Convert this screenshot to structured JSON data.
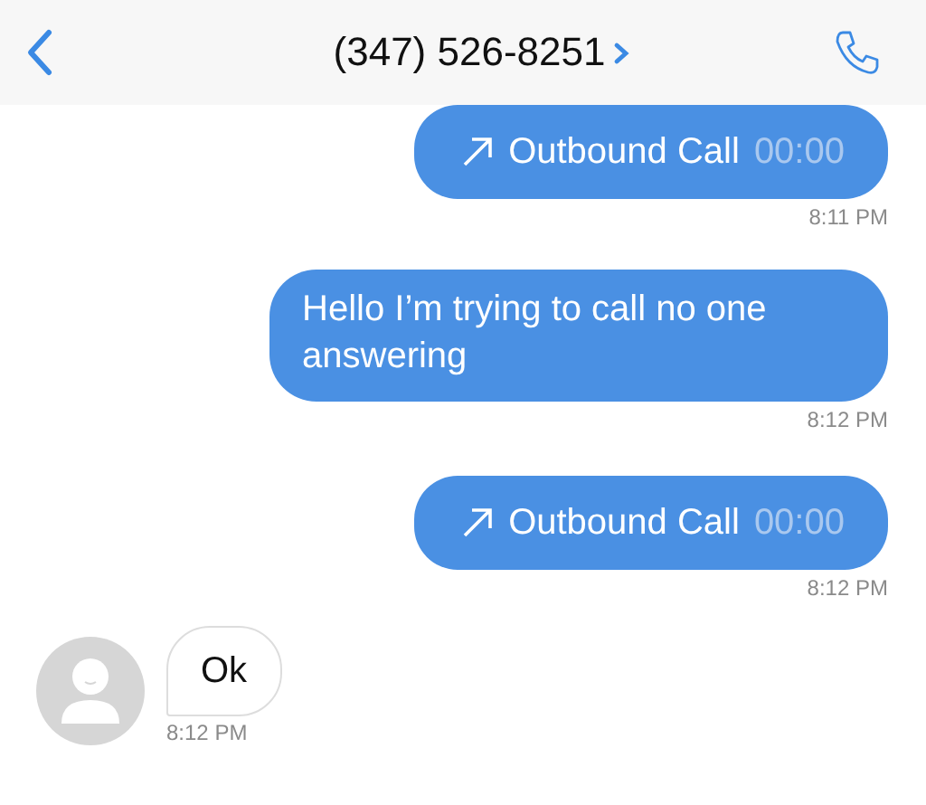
{
  "header": {
    "title": "(347) 526-8251"
  },
  "messages": [
    {
      "kind": "call",
      "sent": true,
      "label": "Outbound Call",
      "duration": "00:00",
      "time": "8:11 PM"
    },
    {
      "kind": "text",
      "sent": true,
      "text": "Hello I’m trying to call no one answering",
      "time": "8:12 PM"
    },
    {
      "kind": "call",
      "sent": true,
      "label": "Outbound Call",
      "duration": "00:00",
      "time": "8:12 PM"
    },
    {
      "kind": "text",
      "sent": false,
      "text": "Ok",
      "time": "8:12 PM"
    }
  ]
}
